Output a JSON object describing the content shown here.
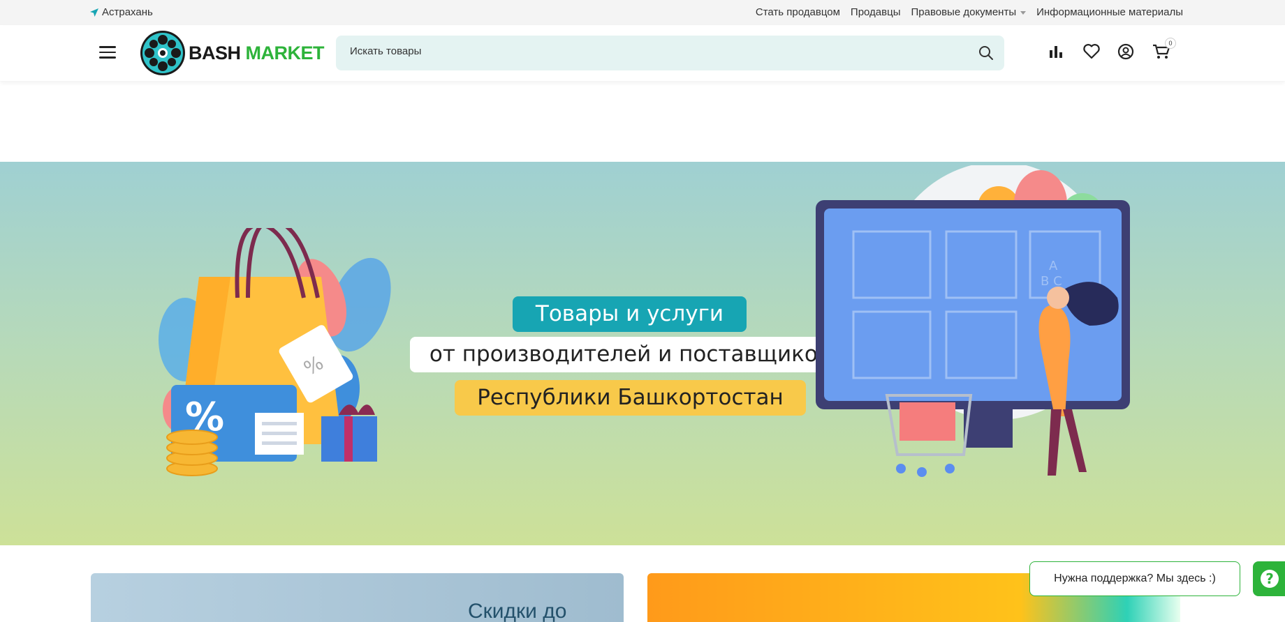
{
  "topbar": {
    "city": "Астрахань",
    "links": [
      {
        "label": "Стать продавцом"
      },
      {
        "label": "Продавцы"
      },
      {
        "label": "Правовые документы"
      },
      {
        "label": "Информационные материалы"
      }
    ]
  },
  "header": {
    "logo_part1": "BASH",
    "logo_part2": "MARKET",
    "search_placeholder": "Искать товары",
    "cart_count": "0"
  },
  "banner": {
    "line1": "Товары и услуги",
    "line2": "от производителей и поставщиков",
    "line3": "Республики Башкортостан"
  },
  "cards": {
    "card1_title": "Скидки до"
  },
  "support": {
    "label": "Нужна поддержка? Мы здесь :)"
  },
  "colors": {
    "accent": "#2db33a",
    "teal": "#17a5b3",
    "yellow": "#f8c94a",
    "search_bg": "#e4f3f2"
  }
}
